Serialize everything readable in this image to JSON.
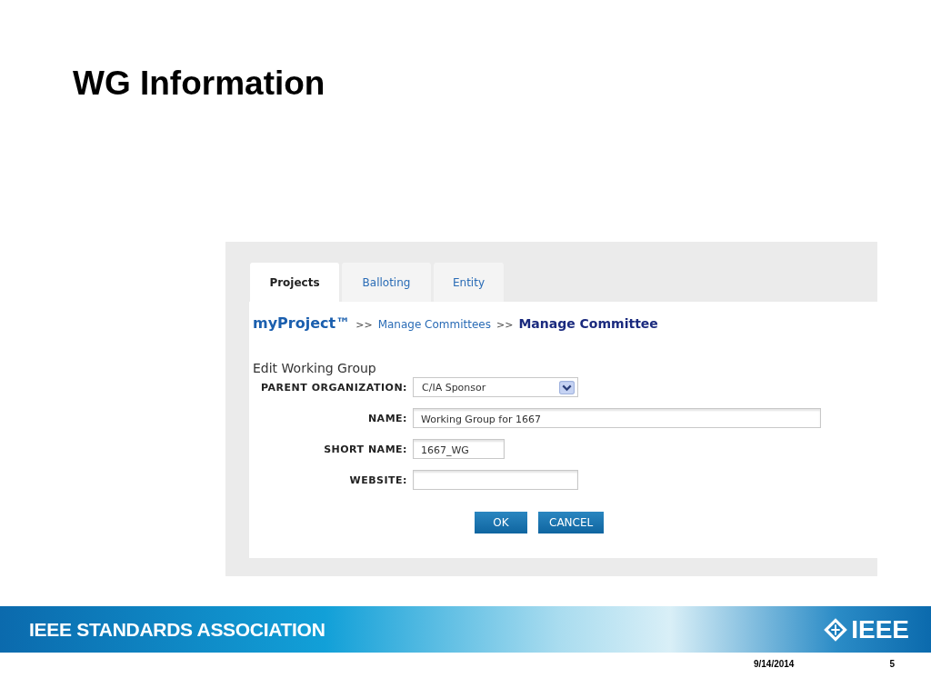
{
  "slide_title": "WG Information",
  "screenshot": {
    "tabs": [
      {
        "label": "Projects",
        "selected": true
      },
      {
        "label": "Balloting",
        "selected": false
      },
      {
        "label": "Entity",
        "selected": false
      }
    ],
    "breadcrumb": [
      {
        "label": "myProject™",
        "kind": "brand"
      },
      {
        "label": ">>",
        "kind": "separator"
      },
      {
        "label": "Manage Committees",
        "kind": "link"
      },
      {
        "label": ">>",
        "kind": "separator"
      },
      {
        "label": "Manage Committee",
        "kind": "current"
      }
    ],
    "form_title": "Edit Working Group",
    "fields": [
      {
        "label": "PARENT ORGANIZATION:",
        "kind": "select",
        "value": "C/IA Sponsor"
      },
      {
        "label": "NAME:",
        "kind": "text",
        "value": "Working Group for 1667"
      },
      {
        "label": "SHORT NAME:",
        "kind": "text",
        "value": "1667_WG"
      },
      {
        "label": "WEBSITE:",
        "kind": "text"
      }
    ],
    "buttons": [
      "OK",
      "CANCEL"
    ]
  },
  "footer": {
    "association": "IEEE STANDARDS ASSOCIATION",
    "logo": "IEEE",
    "date": "9/14/2014",
    "page": "5"
  }
}
